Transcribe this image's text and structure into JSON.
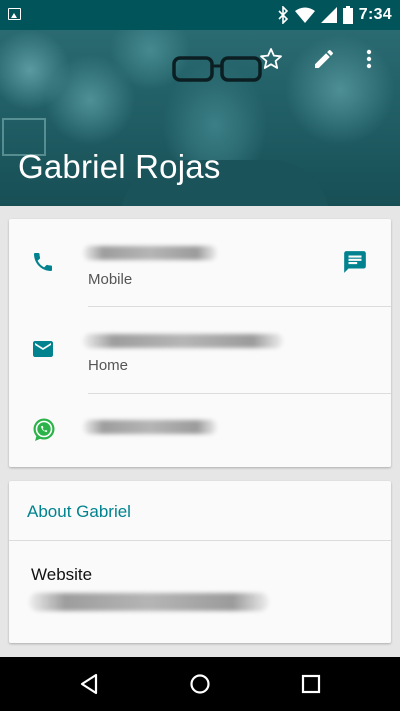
{
  "status_bar": {
    "time": "7:34",
    "icons": [
      "image-notification-icon",
      "bluetooth-icon",
      "wifi-icon",
      "cell-signal-icon",
      "battery-icon"
    ]
  },
  "header": {
    "contact_name": "Gabriel Rojas",
    "actions": [
      "star-icon",
      "edit-icon",
      "more-vert-icon"
    ],
    "accent": "#00545a"
  },
  "contact_card": {
    "phone": {
      "type_label": "Mobile",
      "icon": "phone-icon",
      "action_icon": "message-icon"
    },
    "email": {
      "type_label": "Home",
      "icon": "email-icon"
    },
    "whatsapp": {
      "icon": "whatsapp-icon"
    }
  },
  "about_card": {
    "title": "About Gabriel",
    "website_label": "Website"
  },
  "nav_bar": {
    "buttons": [
      "back-icon",
      "home-icon",
      "recents-icon"
    ]
  },
  "colors": {
    "accent": "#00838f",
    "status_bar": "#00545a",
    "whatsapp": "#2bb34a"
  }
}
